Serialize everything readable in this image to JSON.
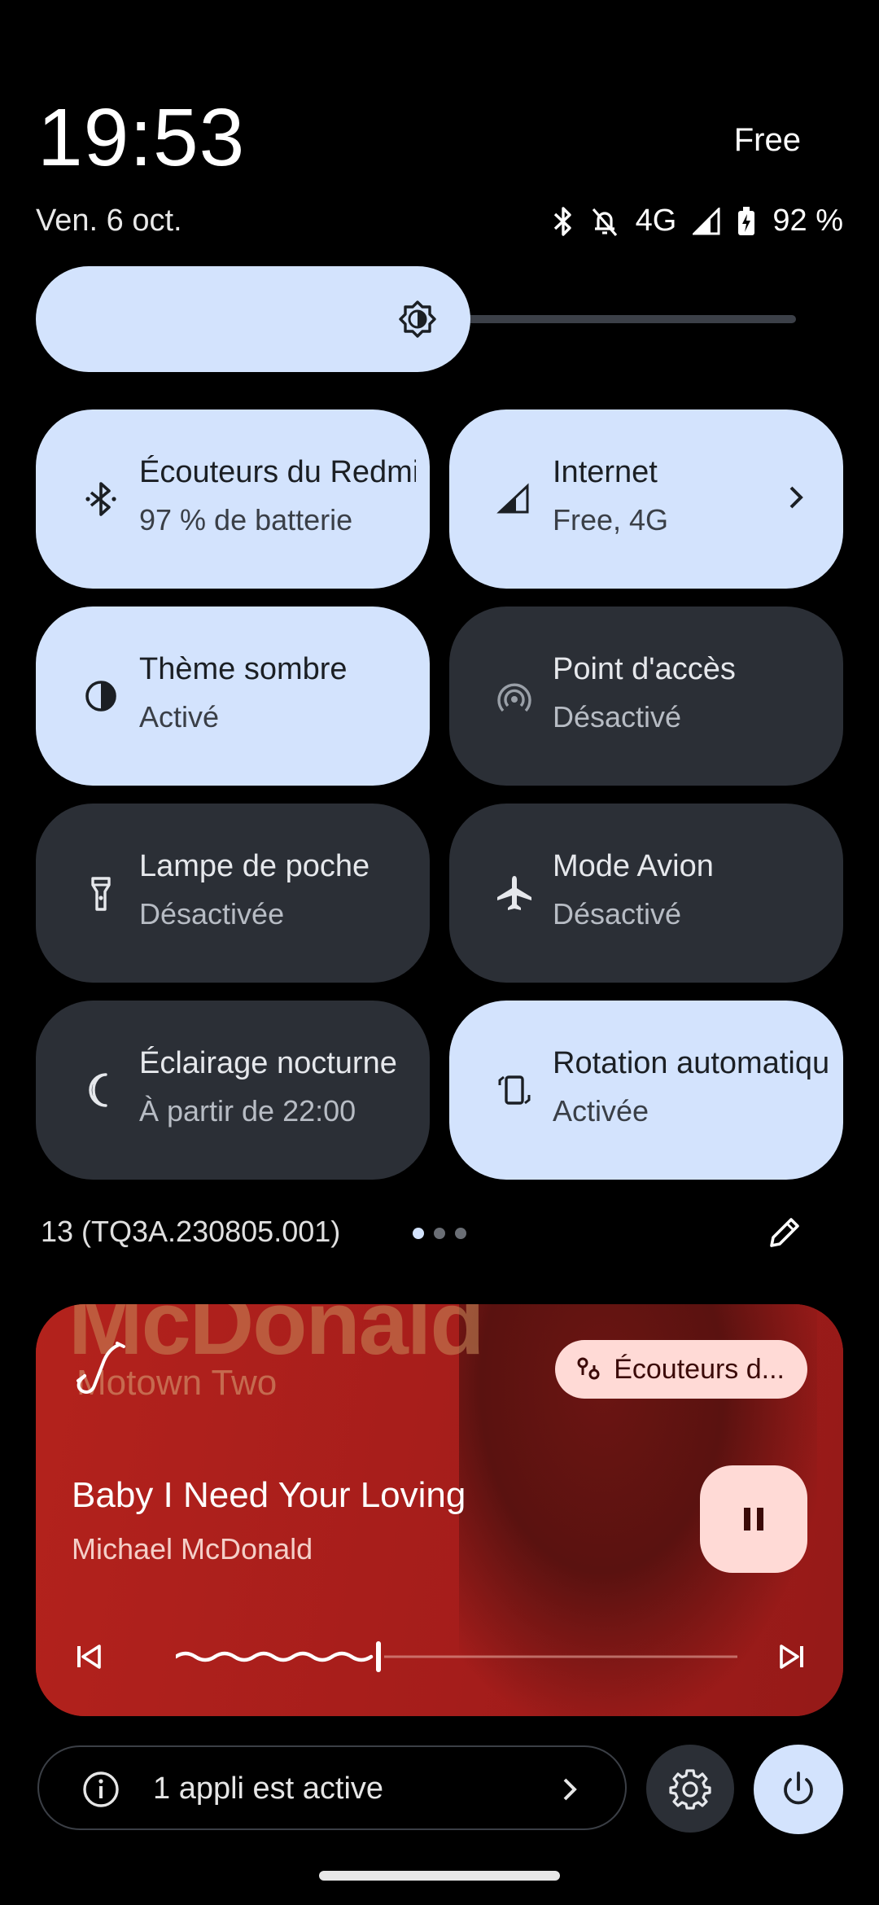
{
  "status": {
    "time": "19:53",
    "carrier": "Free",
    "date": "Ven. 6 oct.",
    "network": "4G",
    "battery": "92 %"
  },
  "brightness": {
    "level": 0.56
  },
  "tiles": [
    {
      "title": "Écouteurs du Redmi",
      "subtitle": "97 % de batterie",
      "state": "on",
      "icon": "bluetooth-icon"
    },
    {
      "title": "Internet",
      "subtitle": "Free, 4G",
      "state": "on",
      "icon": "signal-icon"
    },
    {
      "title": "Thème sombre",
      "subtitle": "Activé",
      "state": "on",
      "icon": "contrast-icon"
    },
    {
      "title": "Point d'accès",
      "subtitle": "Désactivé",
      "state": "off",
      "icon": "hotspot-icon"
    },
    {
      "title": "Lampe de poche",
      "subtitle": "Désactivée",
      "state": "off",
      "icon": "flashlight-icon"
    },
    {
      "title": "Mode Avion",
      "subtitle": "Désactivé",
      "state": "off",
      "icon": "airplane-icon"
    },
    {
      "title": "Éclairage nocturne",
      "subtitle": "À partir de 22:00",
      "state": "off",
      "icon": "moon-icon"
    },
    {
      "title": "Rotation automatique",
      "subtitle": "Activée",
      "state": "on",
      "icon": "rotate-icon"
    }
  ],
  "build": "13 (TQ3A.230805.001)",
  "media": {
    "cover_text": "McDonald",
    "cover_subtext": "Motown Two",
    "output": "Écouteurs d...",
    "title": "Baby I Need Your Loving",
    "artist": "Michael McDonald",
    "progress": 0.36
  },
  "footer": {
    "active_apps": "1 appli est active"
  },
  "colors": {
    "tile_on": "#d3e3fd",
    "tile_off": "#2b2f36",
    "media_bg": "#a81d1d",
    "chip_bg": "#ffdad6"
  }
}
